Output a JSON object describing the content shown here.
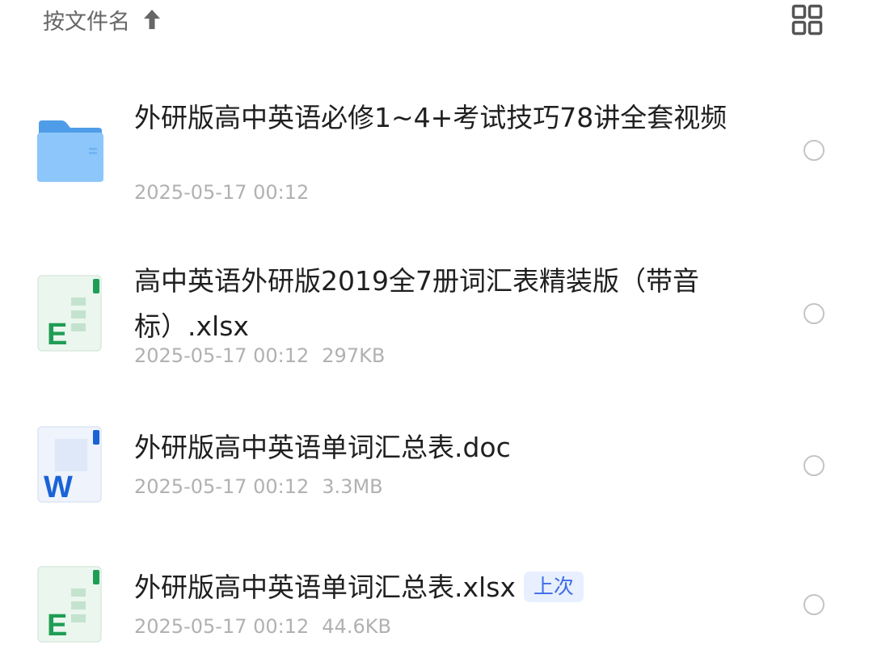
{
  "toolbar": {
    "sort_label": "按文件名",
    "sort_direction_icon": "arrow-up-icon",
    "view_toggle_icon": "grid-view-icon"
  },
  "files": [
    {
      "type": "folder",
      "icon": "folder-icon",
      "name": "外研版高中英语必修1~4+考试技巧78讲全套视频",
      "date": "2025-05-17 00:12",
      "size": ""
    },
    {
      "type": "xlsx",
      "icon": "excel-file-icon",
      "icon_letter": "E",
      "name": "高中英语外研版2019全7册词汇表精装版（带音标）.xlsx",
      "date": "2025-05-17 00:12",
      "size": "297KB"
    },
    {
      "type": "doc",
      "icon": "word-file-icon",
      "icon_letter": "W",
      "name": "外研版高中英语单词汇总表.doc",
      "date": "2025-05-17 00:12",
      "size": "3.3MB"
    },
    {
      "type": "xlsx",
      "icon": "excel-file-icon",
      "icon_letter": "E",
      "name": "外研版高中英语单词汇总表.xlsx",
      "badge": "上次",
      "date": "2025-05-17 00:12",
      "size": "44.6KB"
    }
  ],
  "colors": {
    "folder_blue": "#5aa9f0",
    "excel_green": "#1f9d55",
    "word_blue": "#1a62d6",
    "badge_bg": "#e8efff",
    "badge_text": "#3d6ce8",
    "meta_text": "#b1b1b1"
  }
}
